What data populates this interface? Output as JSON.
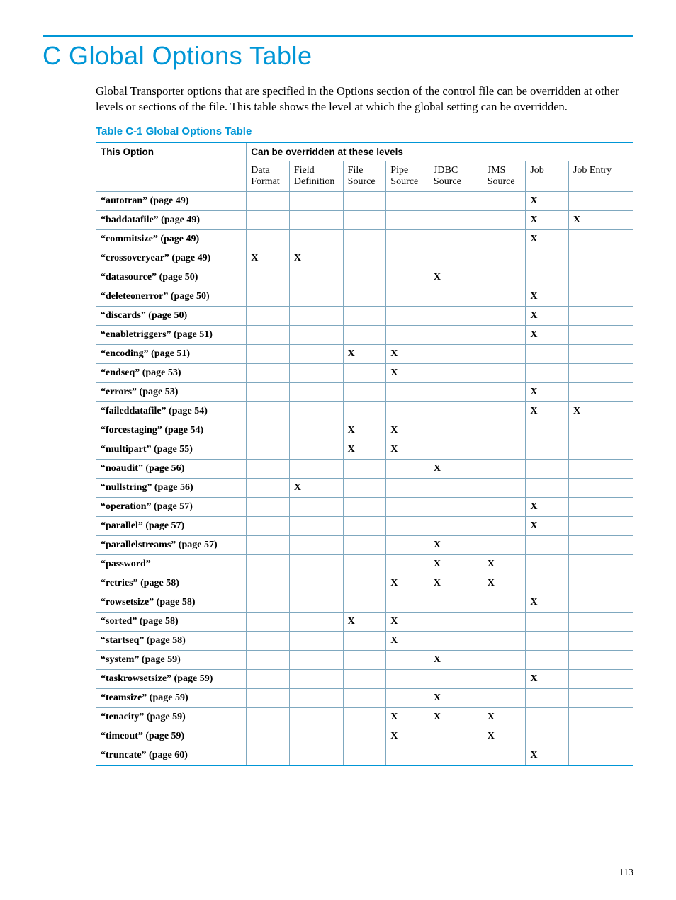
{
  "heading": "C Global Options Table",
  "intro": "Global Transporter options that are specified in the Options section of the control file can be overridden at other levels or sections of the file. This table shows the level at which the global setting can be overridden.",
  "table_caption": "Table C-1 Global Options Table",
  "header": {
    "this_option": "This Option",
    "can_override": "Can be overridden at these levels"
  },
  "columns": [
    "Data Format",
    "Field Definition",
    "File Source",
    "Pipe Source",
    "JDBC Source",
    "JMS Source",
    "Job",
    "Job Entry"
  ],
  "mark": "X",
  "rows": [
    {
      "name": "“autotran” (page 49)",
      "marks": [
        0,
        0,
        0,
        0,
        0,
        0,
        1,
        0
      ]
    },
    {
      "name": "“baddatafile” (page 49)",
      "marks": [
        0,
        0,
        0,
        0,
        0,
        0,
        1,
        1
      ]
    },
    {
      "name": "“commitsize” (page 49)",
      "marks": [
        0,
        0,
        0,
        0,
        0,
        0,
        1,
        0
      ]
    },
    {
      "name": "“crossoveryear” (page 49)",
      "marks": [
        1,
        1,
        0,
        0,
        0,
        0,
        0,
        0
      ]
    },
    {
      "name": "“datasource” (page 50)",
      "marks": [
        0,
        0,
        0,
        0,
        1,
        0,
        0,
        0
      ]
    },
    {
      "name": "“deleteonerror” (page 50)",
      "marks": [
        0,
        0,
        0,
        0,
        0,
        0,
        1,
        0
      ]
    },
    {
      "name": "“discards” (page 50)",
      "marks": [
        0,
        0,
        0,
        0,
        0,
        0,
        1,
        0
      ]
    },
    {
      "name": "“enabletriggers” (page 51)",
      "marks": [
        0,
        0,
        0,
        0,
        0,
        0,
        1,
        0
      ]
    },
    {
      "name": "“encoding” (page 51)",
      "marks": [
        0,
        0,
        1,
        1,
        0,
        0,
        0,
        0
      ]
    },
    {
      "name": "“endseq” (page 53)",
      "marks": [
        0,
        0,
        0,
        1,
        0,
        0,
        0,
        0
      ]
    },
    {
      "name": "“errors” (page 53)",
      "marks": [
        0,
        0,
        0,
        0,
        0,
        0,
        1,
        0
      ]
    },
    {
      "name": "“faileddatafile” (page 54)",
      "marks": [
        0,
        0,
        0,
        0,
        0,
        0,
        1,
        1
      ]
    },
    {
      "name": "“forcestaging” (page 54)",
      "marks": [
        0,
        0,
        1,
        1,
        0,
        0,
        0,
        0
      ]
    },
    {
      "name": "“multipart” (page 55)",
      "marks": [
        0,
        0,
        1,
        1,
        0,
        0,
        0,
        0
      ]
    },
    {
      "name": "“noaudit” (page 56)",
      "marks": [
        0,
        0,
        0,
        0,
        1,
        0,
        0,
        0
      ]
    },
    {
      "name": "“nullstring” (page 56)",
      "marks": [
        0,
        1,
        0,
        0,
        0,
        0,
        0,
        0
      ]
    },
    {
      "name": "“operation” (page 57)",
      "marks": [
        0,
        0,
        0,
        0,
        0,
        0,
        1,
        0
      ]
    },
    {
      "name": "“parallel” (page 57)",
      "marks": [
        0,
        0,
        0,
        0,
        0,
        0,
        1,
        0
      ]
    },
    {
      "name": "“parallelstreams” (page 57)",
      "marks": [
        0,
        0,
        0,
        0,
        1,
        0,
        0,
        0
      ]
    },
    {
      "name": "“password”",
      "marks": [
        0,
        0,
        0,
        0,
        1,
        1,
        0,
        0
      ]
    },
    {
      "name": "“retries” (page 58)",
      "marks": [
        0,
        0,
        0,
        1,
        1,
        1,
        0,
        0
      ]
    },
    {
      "name": "“rowsetsize” (page 58)",
      "marks": [
        0,
        0,
        0,
        0,
        0,
        0,
        1,
        0
      ]
    },
    {
      "name": "“sorted” (page 58)",
      "marks": [
        0,
        0,
        1,
        1,
        0,
        0,
        0,
        0
      ]
    },
    {
      "name": "“startseq” (page 58)",
      "marks": [
        0,
        0,
        0,
        1,
        0,
        0,
        0,
        0
      ]
    },
    {
      "name": "“system” (page 59)",
      "marks": [
        0,
        0,
        0,
        0,
        1,
        0,
        0,
        0
      ]
    },
    {
      "name": "“taskrowsetsize” (page 59)",
      "marks": [
        0,
        0,
        0,
        0,
        0,
        0,
        1,
        0
      ]
    },
    {
      "name": "“teamsize” (page 59)",
      "marks": [
        0,
        0,
        0,
        0,
        1,
        0,
        0,
        0
      ]
    },
    {
      "name": "“tenacity” (page 59)",
      "marks": [
        0,
        0,
        0,
        1,
        1,
        1,
        0,
        0
      ]
    },
    {
      "name": "“timeout” (page 59)",
      "marks": [
        0,
        0,
        0,
        1,
        0,
        1,
        0,
        0
      ]
    },
    {
      "name": "“truncate” (page 60)",
      "marks": [
        0,
        0,
        0,
        0,
        0,
        0,
        1,
        0
      ]
    }
  ],
  "page_number": "113"
}
